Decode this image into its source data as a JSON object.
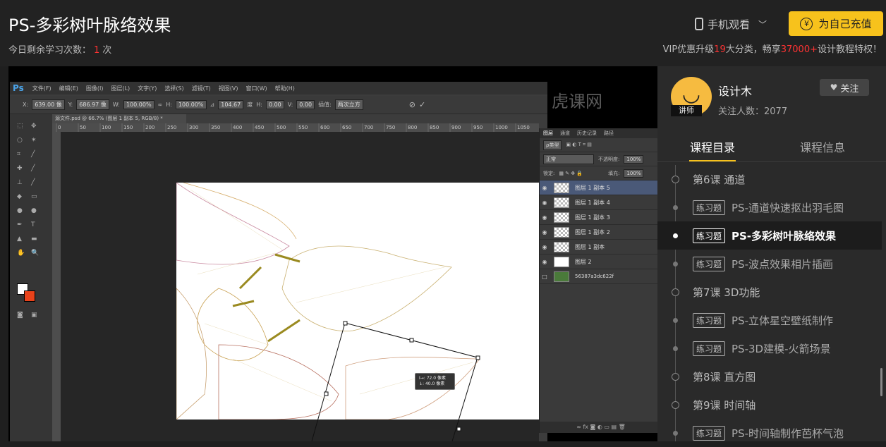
{
  "header": {
    "title": "PS-多彩树叶脉络效果",
    "remain_label": "今日剩余学习次数：",
    "remain_count": "1",
    "remain_unit": "次",
    "mobile_view": "手机观看",
    "recharge": "为自己充值",
    "vip_prefix": "VIP优惠升级",
    "vip_count": "19",
    "vip_mid": "大分类，畅享",
    "vip_num": "37000+",
    "vip_suffix": "设计教程特权！"
  },
  "photoshop": {
    "menu": [
      "文件(F)",
      "编辑(E)",
      "图像(I)",
      "图层(L)",
      "文字(Y)",
      "选择(S)",
      "滤镜(T)",
      "视图(V)",
      "窗口(W)",
      "帮助(H)"
    ],
    "options": {
      "x": "639.00 像",
      "y": "686.97 像",
      "w": "100.00%",
      "h": "100.00%",
      "angle": "104.67",
      "angle_unit": "度",
      "hskew": "0.00",
      "vskew": "0.00",
      "interp_label": "插值:",
      "interp": "两次立方"
    },
    "doc_tab": "源文件.psd @ 66.7% (图层 1 副本 5, RGB/8) *",
    "ruler_ticks": [
      "0",
      "50",
      "100",
      "150",
      "200",
      "250",
      "300",
      "350",
      "400",
      "450",
      "500",
      "550",
      "600",
      "650",
      "700",
      "750",
      "800",
      "850",
      "900",
      "950",
      "1000",
      "1050"
    ],
    "info_tip": [
      "I→: 72.0 像素",
      "↓: 40.0 像素"
    ],
    "layers_tabs": [
      "图层",
      "通道",
      "历史记录",
      "路径"
    ],
    "kind_label": "ρ类型",
    "blend_mode": "正常",
    "opacity_label": "不透明度:",
    "opacity": "100%",
    "lock_label": "锁定:",
    "fill_label": "填充:",
    "fill": "100%",
    "layers": [
      "图层 1 副本 5",
      "图层 1 副本 4",
      "图层 1 副本 3",
      "图层 1 副本 2",
      "图层 1 副本",
      "图层 2",
      "56387a3dc622f"
    ],
    "watermark": "虎课网"
  },
  "sidebar": {
    "author": "设计木",
    "teacher_tag": "讲师",
    "followers": "关注人数：2077",
    "follow": "关注",
    "tabs": [
      "课程目录",
      "课程信息"
    ],
    "items": [
      {
        "type": "lesson",
        "text": "第6课 通道"
      },
      {
        "type": "exercise",
        "tag": "练习题",
        "text": "PS-通道快速抠出羽毛图"
      },
      {
        "type": "exercise",
        "tag": "练习题",
        "text": "PS-多彩树叶脉络效果",
        "active": true
      },
      {
        "type": "exercise",
        "tag": "练习题",
        "text": "PS-波点效果相片插画"
      },
      {
        "type": "lesson",
        "text": "第7课 3D功能"
      },
      {
        "type": "exercise",
        "tag": "练习题",
        "text": "PS-立体星空壁纸制作"
      },
      {
        "type": "exercise",
        "tag": "练习题",
        "text": "PS-3D建模-火箭场景"
      },
      {
        "type": "lesson",
        "text": "第8课 直方图"
      },
      {
        "type": "lesson",
        "text": "第9课 时间轴"
      },
      {
        "type": "exercise",
        "tag": "练习题",
        "text": "PS-时间轴制作芭杯气泡"
      }
    ]
  }
}
